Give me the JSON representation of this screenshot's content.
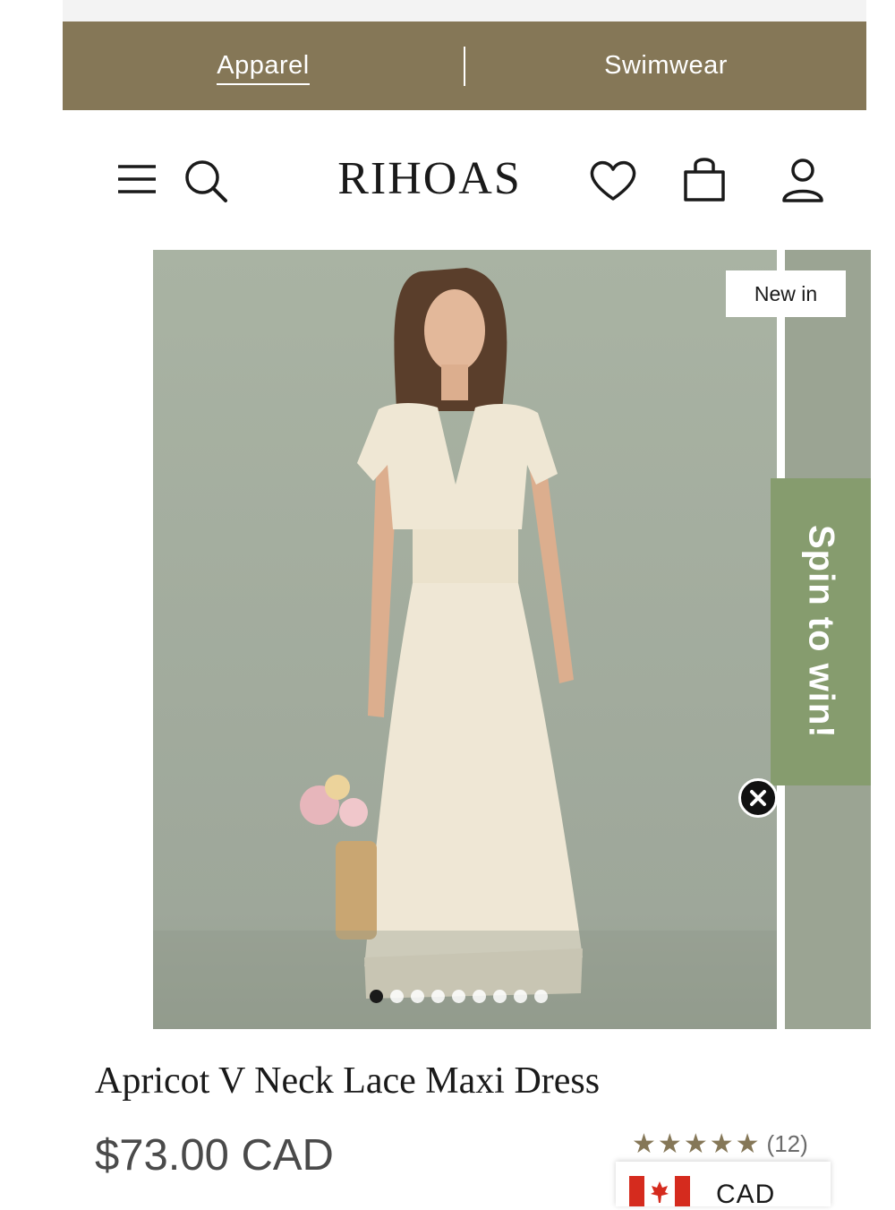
{
  "categories": [
    {
      "label": "Apparel",
      "active": true
    },
    {
      "label": "Swimwear",
      "active": false
    }
  ],
  "header": {
    "brand": "RIHOAS",
    "icons": [
      "menu-icon",
      "search-icon",
      "heart-icon",
      "shopping-bag-icon",
      "user-icon"
    ]
  },
  "gallery": {
    "badge": "New in",
    "slide_count": 9,
    "active_slide": 1
  },
  "promo": {
    "label": "Spin to win!"
  },
  "product": {
    "title": "Apricot V Neck Lace Maxi Dress",
    "price": "$73.00 CAD",
    "rating": 5,
    "review_count": "(12)"
  },
  "currency": {
    "code": "CAD",
    "flag": "canada-flag-icon"
  },
  "colors": {
    "category_bar": "#857757",
    "promo": "#869c6e",
    "star": "#857757"
  }
}
